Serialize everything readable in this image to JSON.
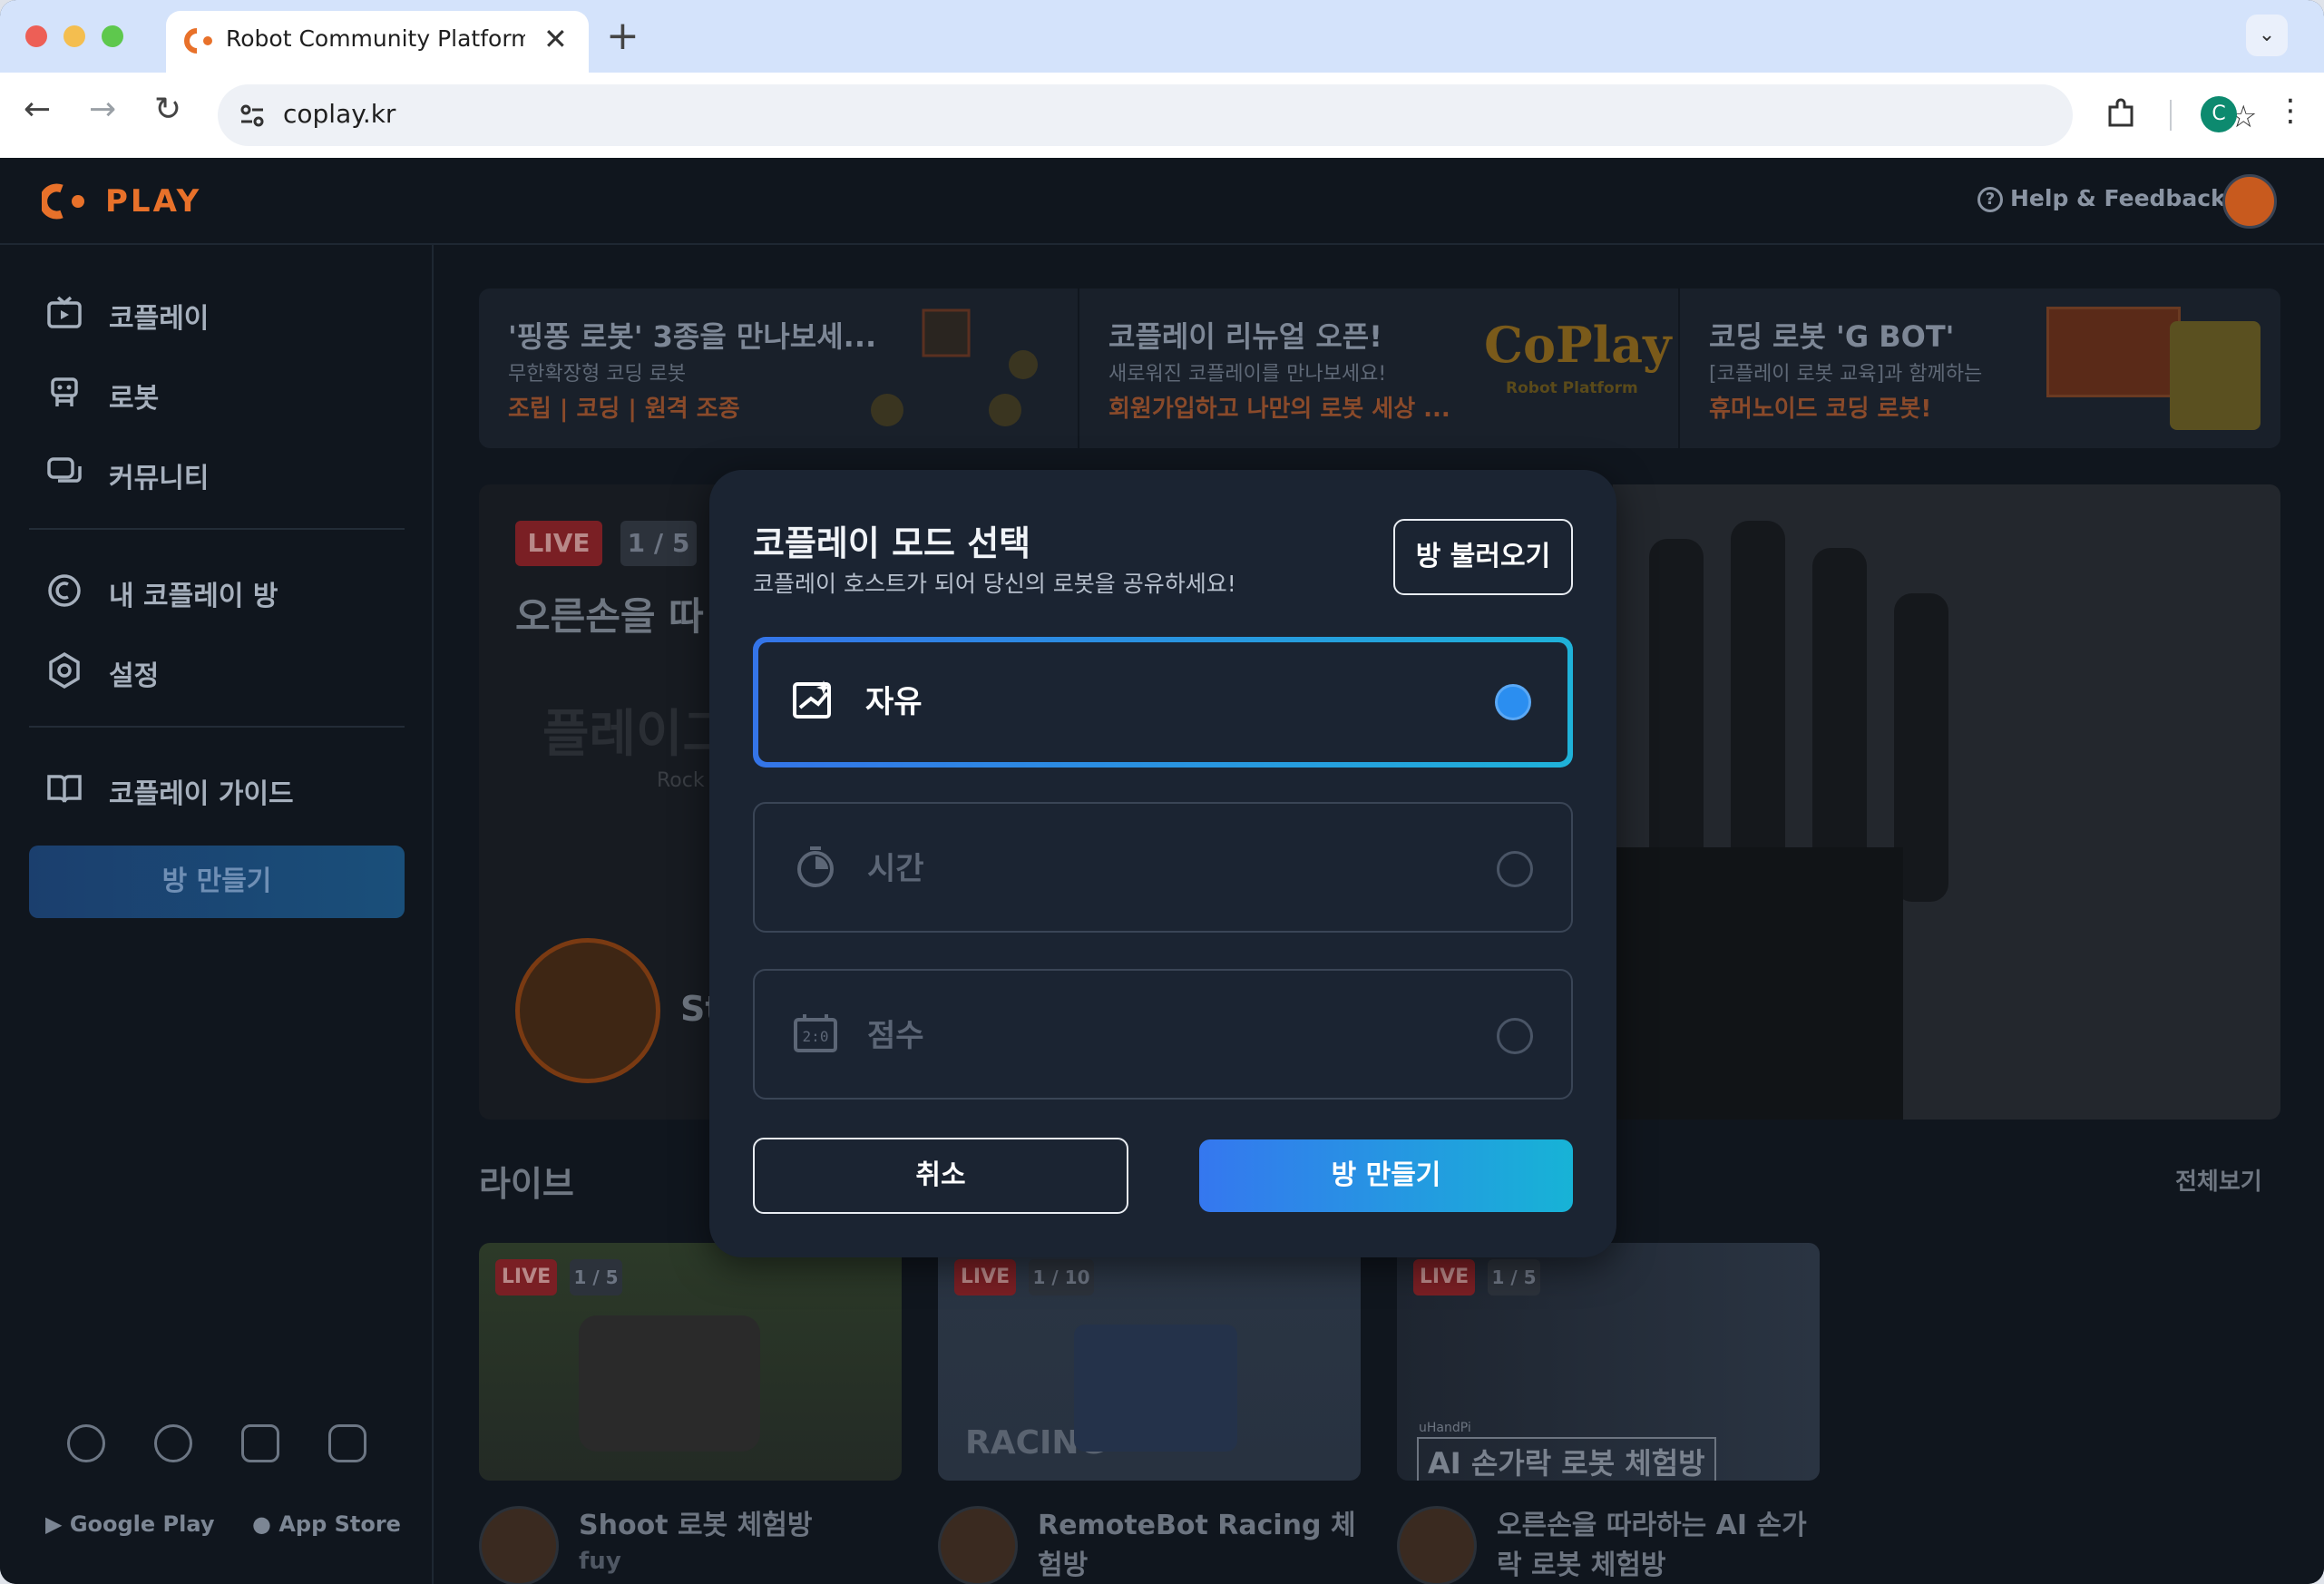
{
  "browser": {
    "tab_title": "Robot Community Platform - C",
    "url": "coplay.kr",
    "profile_initial": "C",
    "new_tab_symbol": "+",
    "tab_close_symbol": "✕"
  },
  "header": {
    "logo_text": "PLAY",
    "help_label": "Help & Feedback"
  },
  "sidebar": {
    "items": [
      {
        "label": "코플레이",
        "icon": "tv-icon"
      },
      {
        "label": "로봇",
        "icon": "robot-icon"
      },
      {
        "label": "커뮤니티",
        "icon": "chat-icon"
      },
      {
        "label": "내 코플레이 방",
        "icon": "coplay-room-icon"
      },
      {
        "label": "설정",
        "icon": "gear-icon"
      },
      {
        "label": "코플레이 가이드",
        "icon": "book-icon"
      }
    ],
    "create_room_label": "방 만들기",
    "stores": {
      "google": "Google Play",
      "apple": "App Store"
    }
  },
  "banners": [
    {
      "title": "'핑퐁 로봇' 3종을 만나보세...",
      "sub": "무한확장형 코딩 로봇",
      "highlight": "조립 | 코딩 | 원격 조종"
    },
    {
      "title": "코플레이 리뉴얼 오픈!",
      "sub": "새로워진 코플레이를 만나보세요!",
      "highlight": "회원가입하고 나만의 로봇 세상 ...",
      "logo": "CoPlay",
      "logo_sub": "Robot Platform"
    },
    {
      "title": "코딩 로봇 'G BOT'",
      "sub": "[코플레이 로봇 교육]과 함께하는",
      "highlight": "휴머노이드 코딩 로봇!"
    }
  ],
  "hero": {
    "live": "LIVE",
    "count": "1 / 5",
    "title": "오른손을 따",
    "faded": "플레이그",
    "faded_small": "Rock",
    "user_partial": "St"
  },
  "live_section": {
    "title": "라이브",
    "view_all": "전체보기",
    "cards": [
      {
        "live": "LIVE",
        "count": "1 / 5",
        "title": "Shoot 로봇 체험방",
        "user": "fuy"
      },
      {
        "live": "LIVE",
        "count": "1 / 10",
        "title": "RemoteBot Racing 체험방",
        "user": "",
        "overlay": "RACING"
      },
      {
        "live": "LIVE",
        "count": "1 / 5",
        "title": "오른손을 따라하는 AI 손가락 로봇 체험방",
        "user": "",
        "overlay_small": "uHandPi",
        "overlay": "AI 손가락 로봇 체험방"
      }
    ]
  },
  "modal": {
    "title": "코플레이 모드 선택",
    "subtitle": "코플레이 호스트가 되어 당신의 로봇을 공유하세요!",
    "load_room": "방 불러오기",
    "options": [
      {
        "label": "자유",
        "icon": "free-mode-icon",
        "selected": true
      },
      {
        "label": "시간",
        "icon": "stopwatch-icon",
        "selected": false
      },
      {
        "label": "점수",
        "icon": "scoreboard-icon",
        "selected": false
      }
    ],
    "cancel": "취소",
    "create": "방 만들기"
  },
  "colors": {
    "accent_gradient_start": "#3474e8",
    "accent_gradient_end": "#1fb2d9",
    "brand_orange": "#e8712a",
    "live_red": "#c7323a"
  }
}
